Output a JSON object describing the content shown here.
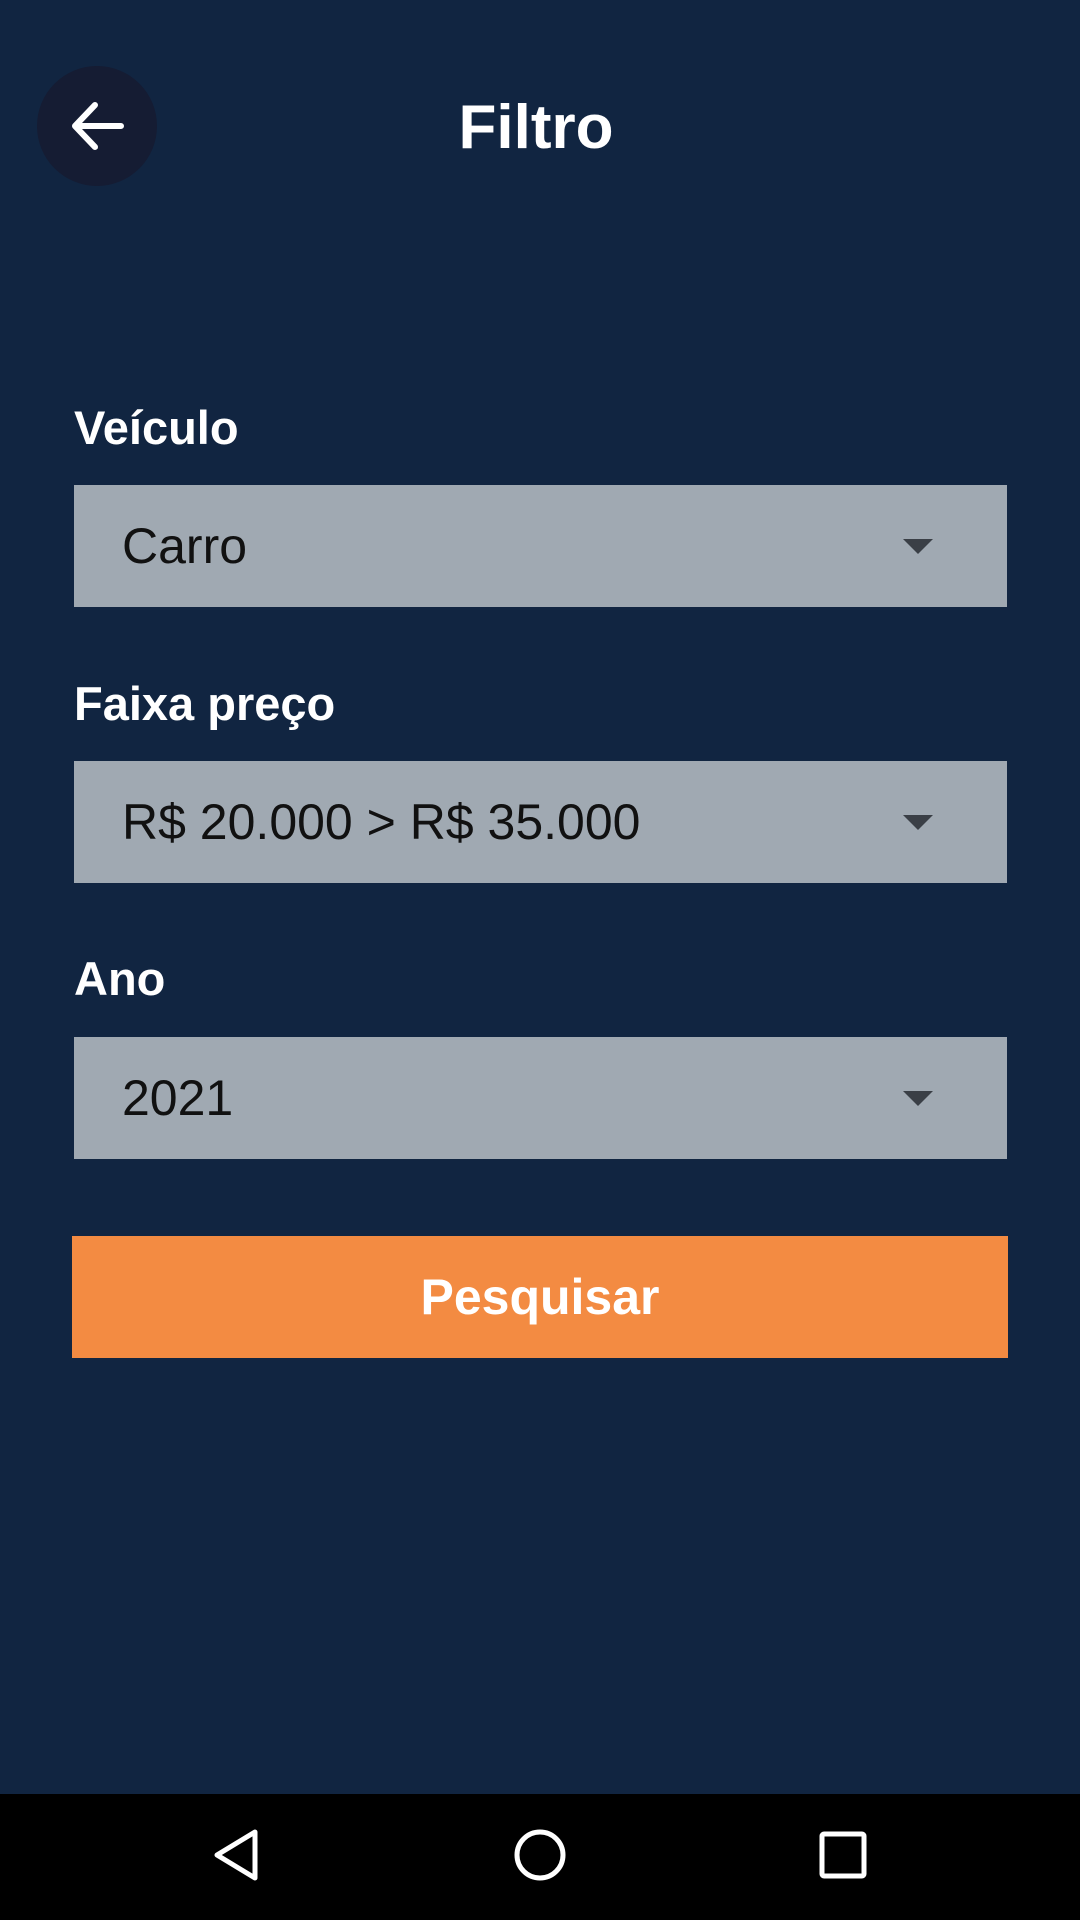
{
  "header": {
    "title": "Filtro",
    "back_icon": "arrow-left-icon"
  },
  "filters": {
    "vehicle": {
      "label": "Veículo",
      "value": "Carro"
    },
    "price_range": {
      "label": "Faixa preço",
      "value": "R$ 20.000 > R$ 35.000"
    },
    "year": {
      "label": "Ano",
      "value": "2021"
    }
  },
  "actions": {
    "search_label": "Pesquisar"
  },
  "nav_bar": {
    "icons": [
      "back-triangle-icon",
      "home-circle-icon",
      "recents-square-icon"
    ]
  },
  "colors": {
    "background": "#112541",
    "back_button_bg": "#151c33",
    "select_bg": "#a0a9b2",
    "accent": "#f38b42",
    "nav_bar_bg": "#000000"
  }
}
